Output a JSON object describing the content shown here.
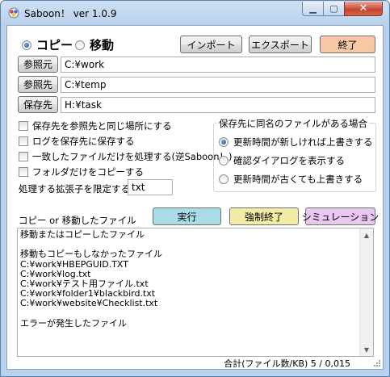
{
  "window": {
    "title": "Saboon！ ver 1.0.9"
  },
  "mode": {
    "copy_label": "コピー",
    "move_label": "移動",
    "selected": "copy"
  },
  "toolbar": {
    "import_label": "インポート",
    "export_label": "エクスポート",
    "exit_label": "終了"
  },
  "paths": {
    "source_button": "参照元",
    "source_value": "C:¥work",
    "dest_button": "参照先",
    "dest_value": "C:¥temp",
    "save_button": "保存先",
    "save_value": "H:¥task"
  },
  "options": [
    {
      "label": "保存先を参照先と同じ場所にする",
      "checked": false
    },
    {
      "label": "ログを保存先に保存する",
      "checked": false
    },
    {
      "label": "一致したファイルだけを処理する(逆Saboon！)",
      "checked": false
    },
    {
      "label": "フォルダだけをコピーする",
      "checked": false
    }
  ],
  "extension": {
    "label": "処理する拡張子を限定する",
    "value": "txt"
  },
  "conflict": {
    "title": "保存先に同名のファイルがある場合",
    "choices": [
      "更新時間が新しければ上書きする",
      "確認ダイアログを表示する",
      "更新時間が古くても上書きする"
    ],
    "selected_index": 0
  },
  "actions": {
    "list_label": "コピー or 移動したファイル",
    "run_label": "実行",
    "run_color": "#a9dce6",
    "force_label": "強制終了",
    "force_color": "#f3eca6",
    "sim_label": "シミュレーション",
    "sim_color": "#e9c8ef"
  },
  "output_lines": [
    "移動またはコピーしたファイル",
    "",
    "移動もコピーもしなかったファイル",
    "C:¥work¥HBEPGUID.TXT",
    "C:¥work¥log.txt",
    "C:¥work¥テスト用ファイル.txt",
    "C:¥work¥folder1¥blackbird.txt",
    "C:¥work¥website¥Checklist.txt",
    "",
    "エラーが発生したファイル"
  ],
  "status": {
    "text": "合計(ファイル数/KB) 5 / 0,015"
  },
  "colors": {
    "exit_button": "#f8c7a5",
    "titlebar": "#b9d1ec"
  }
}
